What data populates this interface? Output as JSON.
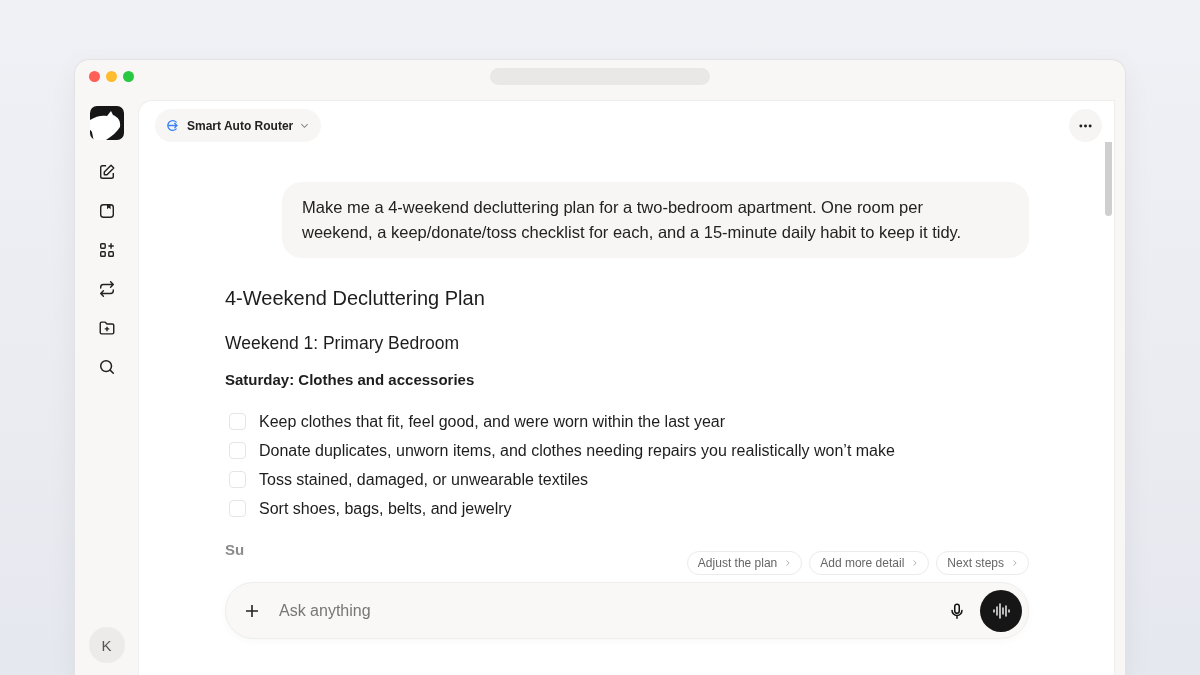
{
  "model_selector": {
    "label": "Smart Auto Router"
  },
  "avatar": {
    "initial": "K"
  },
  "user_message": "Make me a 4-weekend decluttering plan for a two-bedroom apartment. One room per weekend, a keep/donate/toss checklist for each, and a 15-minute daily habit to keep it tidy.",
  "response": {
    "title": "4-Weekend Decluttering Plan",
    "section": "Weekend 1: Primary Bedroom",
    "subsection": "Saturday: Clothes and accessories",
    "checklist": [
      {
        "text": "Keep clothes that fit, feel good, and were worn within the last year",
        "checked": false
      },
      {
        "text": "Donate duplicates, unworn items, and clothes needing repairs you realistically won’t make",
        "checked": false
      },
      {
        "text": "Toss stained, damaged, or unwearable textiles",
        "checked": false
      },
      {
        "text": "Sort shoes, bags, belts, and jewelry",
        "checked": false
      }
    ],
    "next_heading_partial": "Su"
  },
  "suggestions": [
    "Adjust the plan",
    "Add more detail",
    "Next steps"
  ],
  "composer": {
    "placeholder": "Ask anything"
  }
}
